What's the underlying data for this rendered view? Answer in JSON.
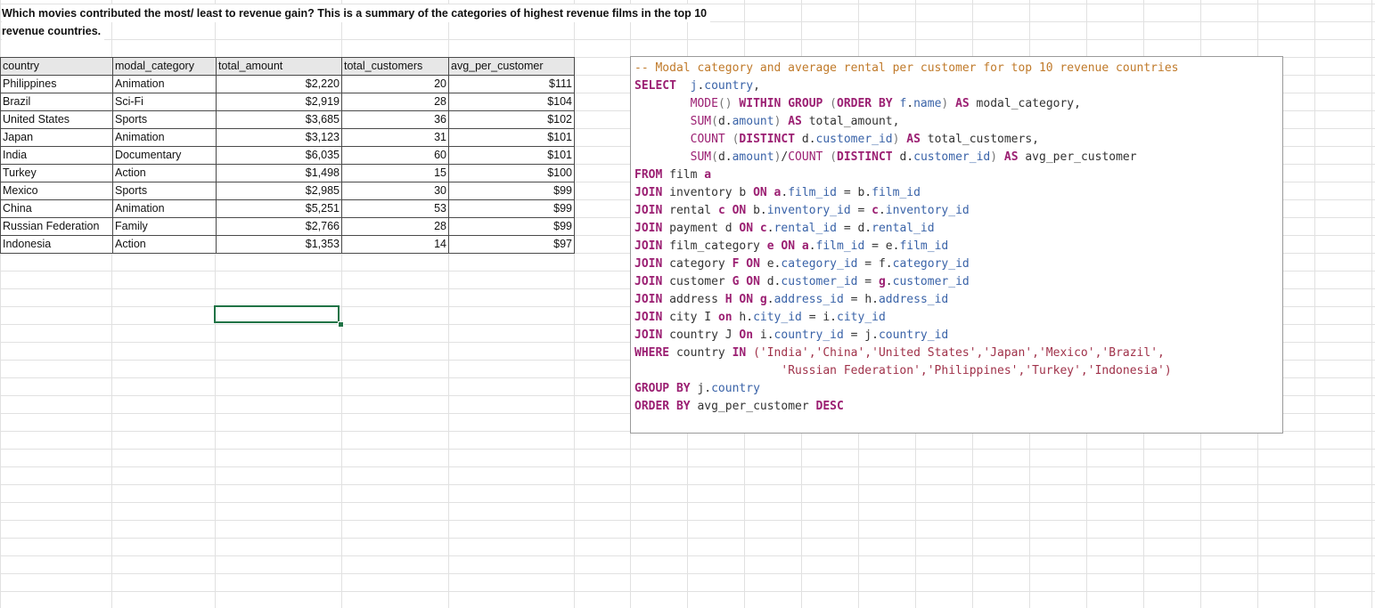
{
  "question_line1": "Which movies contributed the most/ least to revenue gain? This is a summary of the categories of highest revenue films in the top 10",
  "question_line2": "revenue countries.",
  "table": {
    "headers": [
      "country",
      "modal_category",
      "total_amount",
      "total_customers",
      "avg_per_customer"
    ],
    "rows": [
      [
        "Philippines",
        "Animation",
        "$2,220",
        "20",
        "$111"
      ],
      [
        "Brazil",
        "Sci-Fi",
        "$2,919",
        "28",
        "$104"
      ],
      [
        "United States",
        "Sports",
        "$3,685",
        "36",
        "$102"
      ],
      [
        "Japan",
        "Animation",
        "$3,123",
        "31",
        "$101"
      ],
      [
        "India",
        "Documentary",
        "$6,035",
        "60",
        "$101"
      ],
      [
        "Turkey",
        "Action",
        "$1,498",
        "15",
        "$100"
      ],
      [
        "Mexico",
        "Sports",
        "$2,985",
        "30",
        "$99"
      ],
      [
        "China",
        "Animation",
        "$5,251",
        "53",
        "$99"
      ],
      [
        "Russian Federation",
        "Family",
        "$2,766",
        "28",
        "$99"
      ],
      [
        "Indonesia",
        "Action",
        "$1,353",
        "14",
        "$97"
      ]
    ]
  },
  "sql": {
    "comment": "-- Modal category and average rental per customer for top 10 revenue countries",
    "select": "SELECT",
    "from": "FROM",
    "join": "JOIN",
    "where": "WHERE",
    "group_by": "GROUP BY",
    "order_by": "ORDER BY",
    "countries_line1": "('India','China','United States','Japan','Mexico','Brazil',",
    "countries_line2": "'Russian Federation','Philippines','Turkey','Indonesia')"
  },
  "colors": {
    "keyword": "#9b1f72",
    "comment": "#c07a2a",
    "identifier": "#3a63a8",
    "string": "#a0324a",
    "selection": "#217346"
  }
}
